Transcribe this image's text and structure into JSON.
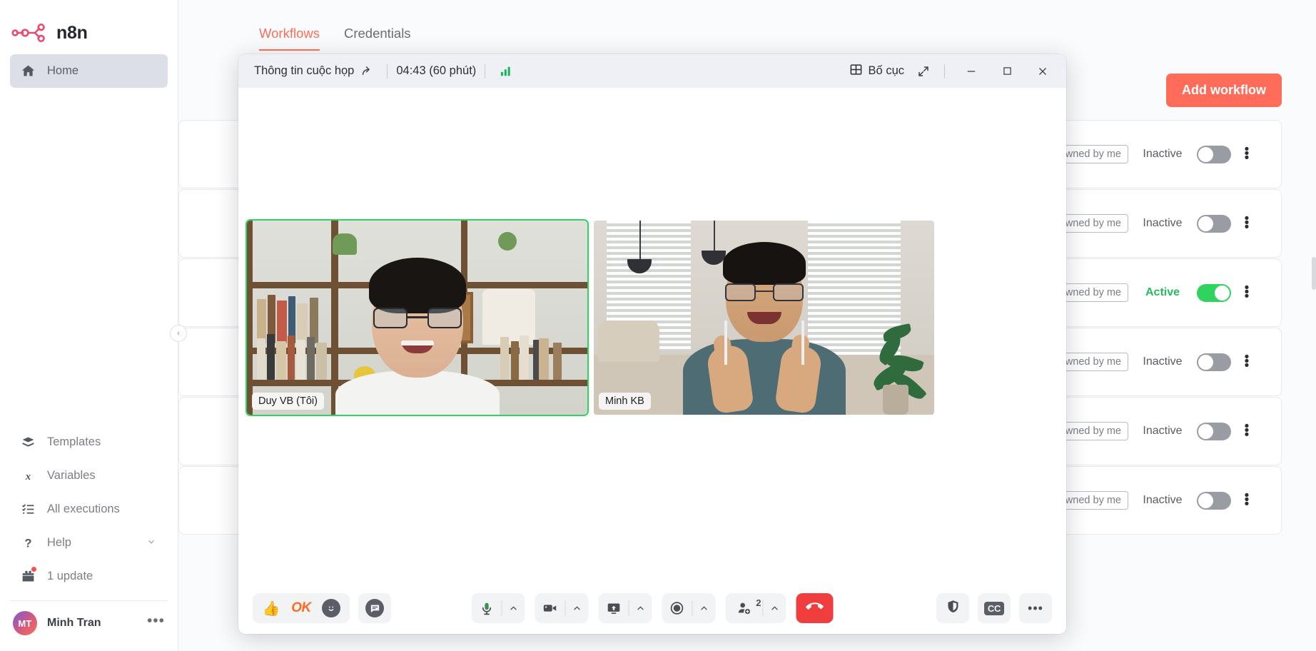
{
  "sidebar": {
    "brand": "n8n",
    "top_items": [
      {
        "label": "Home",
        "icon": "home-icon",
        "active": true
      }
    ],
    "bottom_items": [
      {
        "label": "Templates",
        "icon": "templates-icon",
        "chevron": ""
      },
      {
        "label": "Variables",
        "icon": "variables-icon",
        "chevron": ""
      },
      {
        "label": "All executions",
        "icon": "executions-list-icon",
        "chevron": ""
      },
      {
        "label": "Help",
        "icon": "help-question-icon",
        "chevron": "⌄"
      },
      {
        "label": "1 update",
        "icon": "gift-icon",
        "chevron": ""
      }
    ],
    "user": {
      "initials": "MT",
      "name": "Minh Tran",
      "menu": "•••"
    },
    "collapse_icon": "‹"
  },
  "main": {
    "tabs": [
      {
        "label": "Workflows",
        "active": true
      },
      {
        "label": "Credentials",
        "active": false
      }
    ],
    "add_workflow_label": "Add workflow",
    "workflow_rows": [
      {
        "owner": "Owned by me",
        "status": "Inactive",
        "active": false
      },
      {
        "owner": "Owned by me",
        "status": "Inactive",
        "active": false
      },
      {
        "owner": "Owned by me",
        "status": "Active",
        "active": true
      },
      {
        "owner": "Owned by me",
        "status": "Inactive",
        "active": false
      },
      {
        "owner": "Owned by me",
        "status": "Inactive",
        "active": false
      },
      {
        "owner": "Owned by me",
        "status": "Inactive",
        "active": false
      }
    ]
  },
  "meeting": {
    "header": {
      "title": "Thông tin cuộc họp",
      "share_icon": "share-arrow-icon",
      "timer": "04:43  (60 phút)",
      "signal_icon": "signal-bars-icon",
      "layout_label": "Bố cục",
      "layout_icon": "grid-layout-icon",
      "expand_icon": "expand-diagonal-icon",
      "minimize_icon": "—",
      "maximize_icon": "□",
      "close_icon": "✕"
    },
    "participants": [
      {
        "name": "Duy VB (Tôi)",
        "speaking": true
      },
      {
        "name": "Minh KB",
        "speaking": false
      }
    ],
    "toolbar": {
      "reactions": [
        {
          "name": "thumbs-up-reaction",
          "glyph": "👍"
        },
        {
          "name": "ok-reaction",
          "glyph": "OK"
        },
        {
          "name": "emoji-reaction",
          "glyph": "☺"
        }
      ],
      "chat_label": "chat-bubble-icon",
      "mic_label": "microphone-icon",
      "camera_label": "camera-icon",
      "share_screen_label": "share-screen-icon",
      "record_label": "record-icon",
      "participants_label": "participants-icon",
      "participants_count": "2",
      "end_call_label": "end-call-icon",
      "shield_label": "shield-icon",
      "cc_label": "CC",
      "more_label": "•••",
      "chevron": "⌃"
    }
  },
  "colors": {
    "accent": "#ff6d5a",
    "active_green": "#2fd45f",
    "end_call_red": "#f03e3e",
    "sidebar_active_bg": "#dcdfe7"
  }
}
